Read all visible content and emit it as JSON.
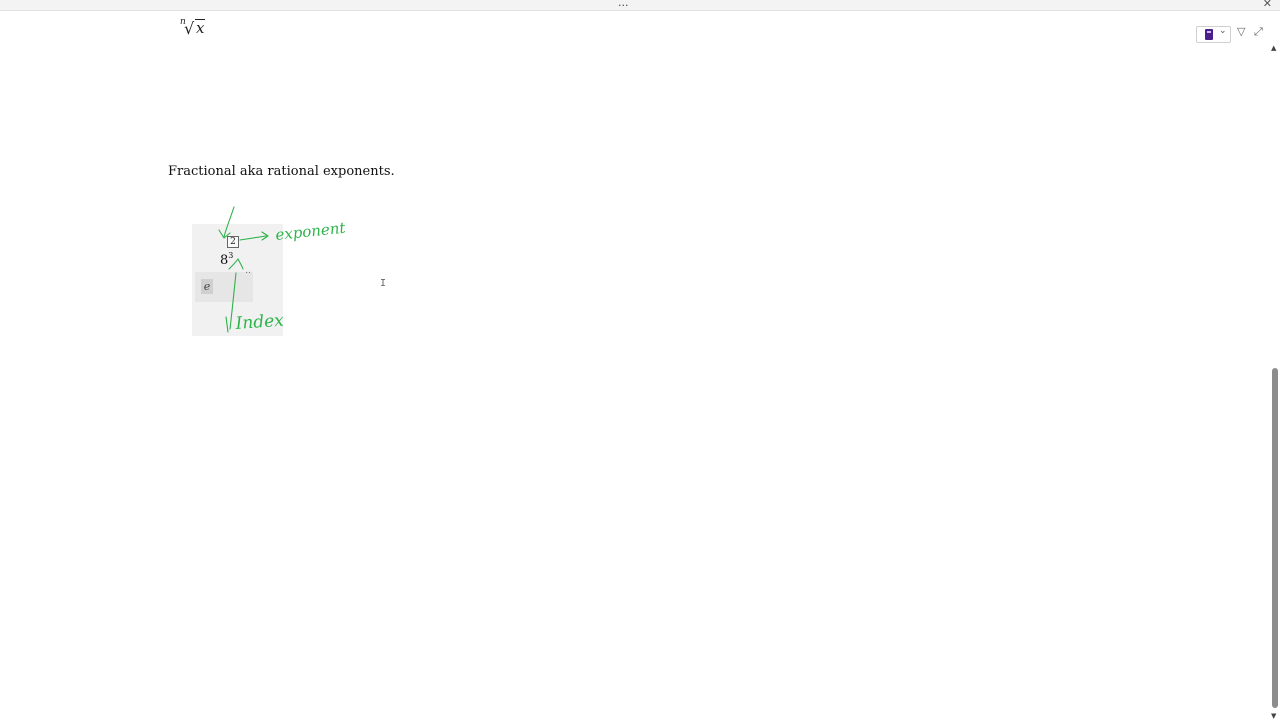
{
  "window": {
    "menu_dots": "...",
    "close_glyph": "✕"
  },
  "radical_example": {
    "index": "n",
    "symbol": "√",
    "argument": "x"
  },
  "heading": "Fractional aka rational exponents.",
  "math_example": {
    "base": "8",
    "exponent_denominator": "3",
    "exponent_numerator": "2",
    "placeholder_cell": "e",
    "more_dots": ".."
  },
  "annotations": {
    "exponent_label": "exponent",
    "index_label": "Index",
    "ink_color": "#2db34a"
  },
  "toolbar": {
    "calculator_icon": "calculator-icon",
    "chevron": "⌄",
    "filter_glyph": "▽",
    "expand_glyph": "⤢",
    "accent_color": "#4a1f8c"
  },
  "scrollbar": {
    "up_glyph": "▲",
    "down_glyph": "▼",
    "position_fraction": 0.49
  }
}
